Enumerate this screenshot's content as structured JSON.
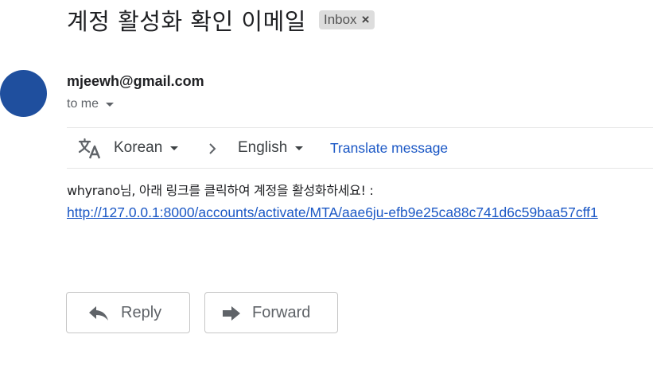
{
  "email": {
    "subject": "계정 활성화 확인 이메일",
    "label": "Inbox",
    "label_remove": "×",
    "sender": "mjeewh@gmail.com",
    "recipient": "to me",
    "avatar_color": "#1f4f9e"
  },
  "translate_bar": {
    "icon": "translate-icon",
    "source_language": "Korean",
    "target_language": "English",
    "action": "Translate message"
  },
  "body": {
    "greeting": "whyrano님, 아래 링크를 클릭하여 계정을 활성화하세요! :",
    "link": "http://127.0.0.1:8000/accounts/activate/MTA/aae6ju-efb9e25ca88c741d6c59baa57cff1"
  },
  "actions": {
    "reply_label": "Reply",
    "forward_label": "Forward"
  },
  "colors": {
    "link": "#1a57c5",
    "text": "#202124",
    "secondary": "#5f6368",
    "chip_bg": "#dddddd"
  }
}
